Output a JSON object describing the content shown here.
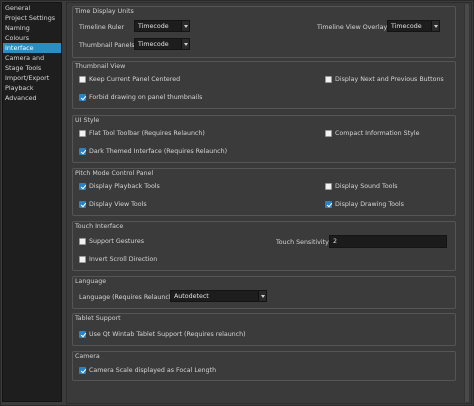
{
  "sidebar": {
    "items": [
      {
        "label": "General"
      },
      {
        "label": "Project Settings"
      },
      {
        "label": "Naming"
      },
      {
        "label": "Colours"
      },
      {
        "label": "Interface",
        "active": true
      },
      {
        "label": "Camera and Stage Tools"
      },
      {
        "label": "Import/Export"
      },
      {
        "label": "Playback"
      },
      {
        "label": "Advanced"
      }
    ]
  },
  "time_display": {
    "title": "Time Display Units",
    "timeline_ruler_label": "Timeline Ruler",
    "timeline_ruler_value": "Timecode",
    "thumbnail_panels_label": "Thumbnail Panels",
    "thumbnail_panels_value": "Timecode",
    "timeline_overlays_label": "Timeline View Overlays",
    "timeline_overlays_value": "Timecode"
  },
  "thumbnail_view": {
    "title": "Thumbnail View",
    "keep_centered": {
      "label": "Keep Current Panel Centered",
      "checked": false
    },
    "display_next_prev": {
      "label": "Display Next and Previous Buttons",
      "checked": false
    },
    "forbid_drawing": {
      "label": "Forbid drawing on panel thumbnails",
      "checked": true
    }
  },
  "ui_style": {
    "title": "UI Style",
    "flat_toolbar": {
      "label": "Flat Tool Toolbar (Requires Relaunch)",
      "checked": false
    },
    "compact_info": {
      "label": "Compact Information Style",
      "checked": false
    },
    "dark_theme": {
      "label": "Dark Themed Interface (Requires Relaunch)",
      "checked": true
    }
  },
  "pitch_mode": {
    "title": "Pitch Mode Control Panel",
    "playback_tools": {
      "label": "Display Playback Tools",
      "checked": true
    },
    "sound_tools": {
      "label": "Display Sound Tools",
      "checked": false
    },
    "view_tools": {
      "label": "Display View Tools",
      "checked": true
    },
    "drawing_tools": {
      "label": "Display Drawing Tools",
      "checked": true
    }
  },
  "touch": {
    "title": "Touch Interface",
    "support_gestures": {
      "label": "Support Gestures",
      "checked": false
    },
    "invert_scroll": {
      "label": "Invert Scroll Direction",
      "checked": false
    },
    "sensitivity_label": "Touch Sensitivity",
    "sensitivity_value": "2"
  },
  "language": {
    "title": "Language",
    "label": "Language (Requires Relaunch)",
    "value": "Autodetect"
  },
  "tablet": {
    "title": "Tablet Support",
    "wintab": {
      "label": "Use Qt Wintab Tablet Support (Requires relaunch)",
      "checked": true
    }
  },
  "camera": {
    "title": "Camera",
    "scale_focal": {
      "label": "Camera Scale displayed as Focal Length",
      "checked": true
    }
  },
  "colors": {
    "accent": "#2a8fc0",
    "checkbox_checked": "#2a82c6",
    "background": "#3a3a3a",
    "sidebar_bg": "#1e1e1e"
  }
}
